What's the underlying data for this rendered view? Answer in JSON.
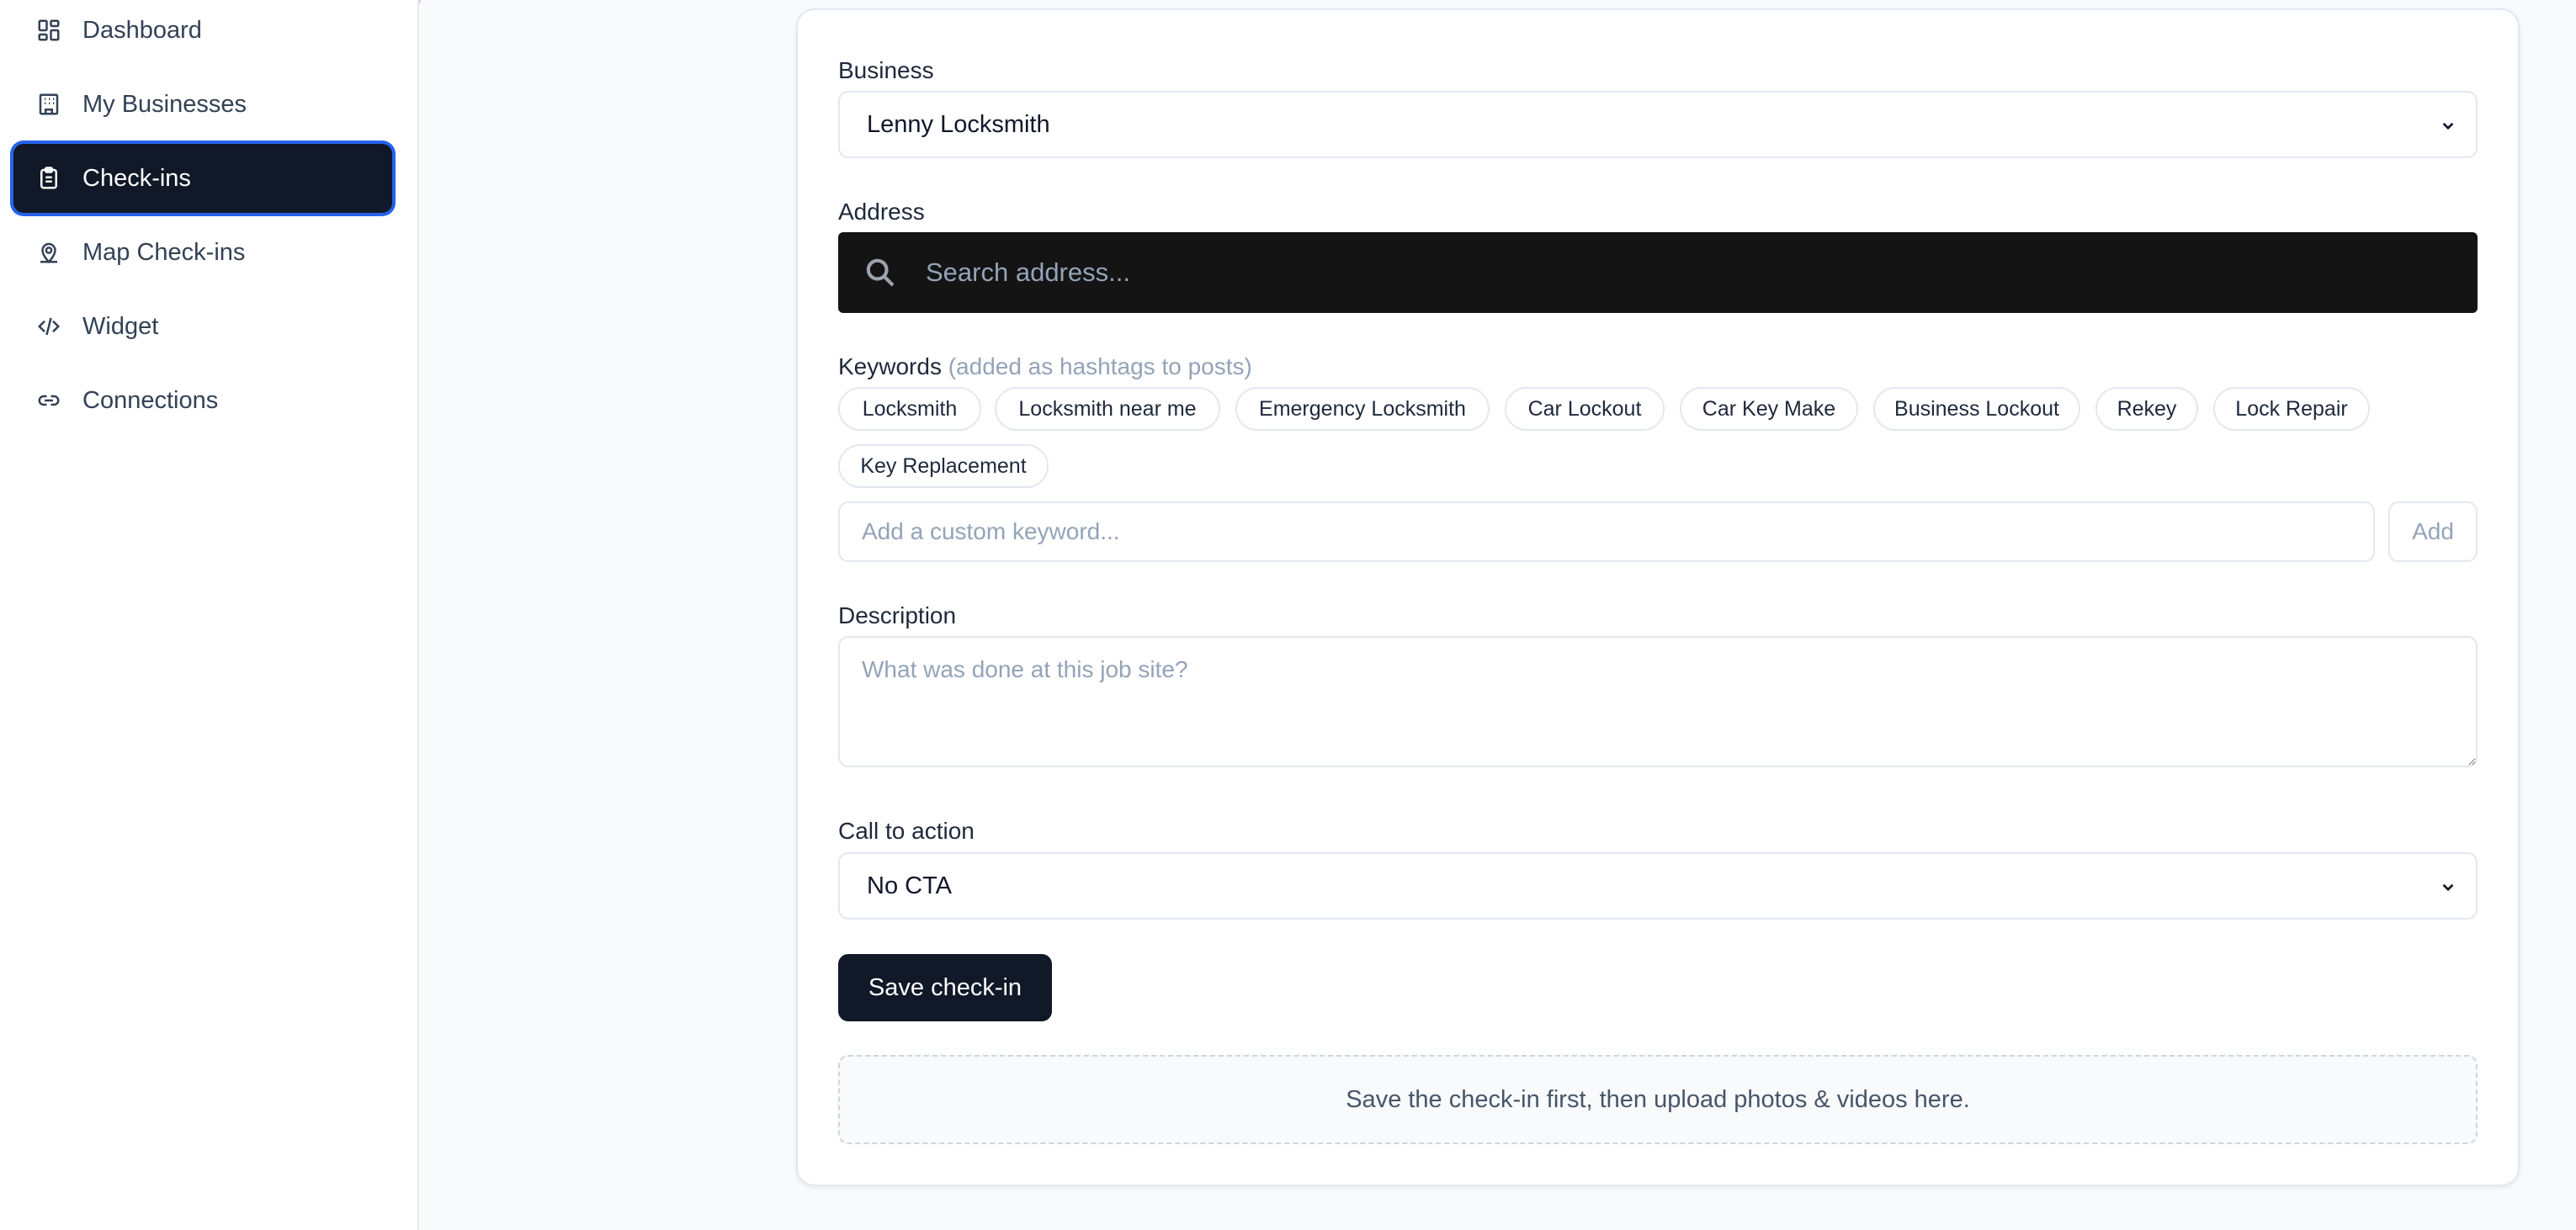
{
  "sidebar": {
    "items": [
      {
        "label": "Dashboard",
        "icon": "dashboard-icon",
        "active": false
      },
      {
        "label": "My Businesses",
        "icon": "building-icon",
        "active": false
      },
      {
        "label": "Check-ins",
        "icon": "clipboard-icon",
        "active": true
      },
      {
        "label": "Map Check-ins",
        "icon": "map-pin-icon",
        "active": false
      },
      {
        "label": "Widget",
        "icon": "code-icon",
        "active": false
      },
      {
        "label": "Connections",
        "icon": "link-icon",
        "active": false
      }
    ]
  },
  "form": {
    "business": {
      "label": "Business",
      "value": "Lenny Locksmith"
    },
    "address": {
      "label": "Address",
      "placeholder": "Search address..."
    },
    "keywords": {
      "label": "Keywords",
      "hint": "(added as hashtags to posts)",
      "chips": [
        "Locksmith",
        "Locksmith near me",
        "Emergency Locksmith",
        "Car Lockout",
        "Car Key Make",
        "Business Lockout",
        "Rekey",
        "Lock Repair",
        "Key Replacement"
      ],
      "custom_placeholder": "Add a custom keyword...",
      "add_label": "Add"
    },
    "description": {
      "label": "Description",
      "placeholder": "What was done at this job site?"
    },
    "cta": {
      "label": "Call to action",
      "value": "No CTA"
    },
    "save_label": "Save check-in",
    "upload_note": "Save the check-in first, then upload photos & videos here."
  },
  "colors": {
    "active_nav_bg": "#111827",
    "active_nav_ring": "#2563eb",
    "address_bg": "#141414",
    "primary_button": "#111827"
  }
}
